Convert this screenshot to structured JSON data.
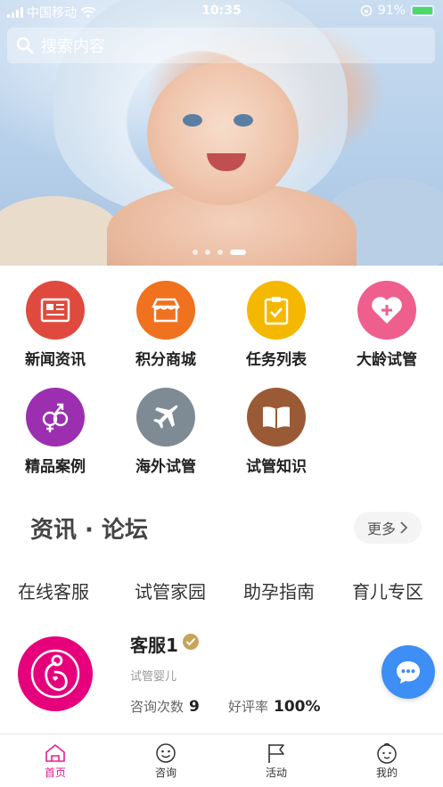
{
  "status_bar": {
    "carrier": "中国移动",
    "time": "10:35",
    "battery": "91%"
  },
  "search": {
    "placeholder": "搜索内容"
  },
  "banner": {
    "page_count": 4,
    "active_page": 4
  },
  "features": [
    {
      "label": "新闻资讯",
      "color": "#e04a3e",
      "icon": "newspaper-icon"
    },
    {
      "label": "积分商城",
      "color": "#f0711e",
      "icon": "store-icon"
    },
    {
      "label": "任务列表",
      "color": "#f5b800",
      "icon": "clipboard-check-icon"
    },
    {
      "label": "大龄试管",
      "color": "#ef5f8e",
      "icon": "heart-plus-icon"
    },
    {
      "label": "精品案例",
      "color": "#9b2fb0",
      "icon": "gender-icon"
    },
    {
      "label": "海外试管",
      "color": "#7e8b95",
      "icon": "airplane-icon"
    },
    {
      "label": "试管知识",
      "color": "#9a5a36",
      "icon": "book-icon"
    }
  ],
  "forum": {
    "title": "资讯 · 论坛",
    "more_label": "更多",
    "tabs": [
      "在线客服",
      "试管家园",
      "助孕指南",
      "育儿专区"
    ]
  },
  "service": {
    "name": "客服1",
    "subtitle": "试管婴儿",
    "consult_label": "咨询次数",
    "consult_value": "9",
    "rating_label": "好评率",
    "rating_value": "100%"
  },
  "nav": {
    "items": [
      {
        "label": "首页",
        "icon": "home-icon",
        "active": true
      },
      {
        "label": "咨询",
        "icon": "smile-icon",
        "active": false
      },
      {
        "label": "活动",
        "icon": "flag-icon",
        "active": false
      },
      {
        "label": "我的",
        "icon": "baby-face-icon",
        "active": false
      }
    ],
    "active_color": "#e91e8c"
  }
}
